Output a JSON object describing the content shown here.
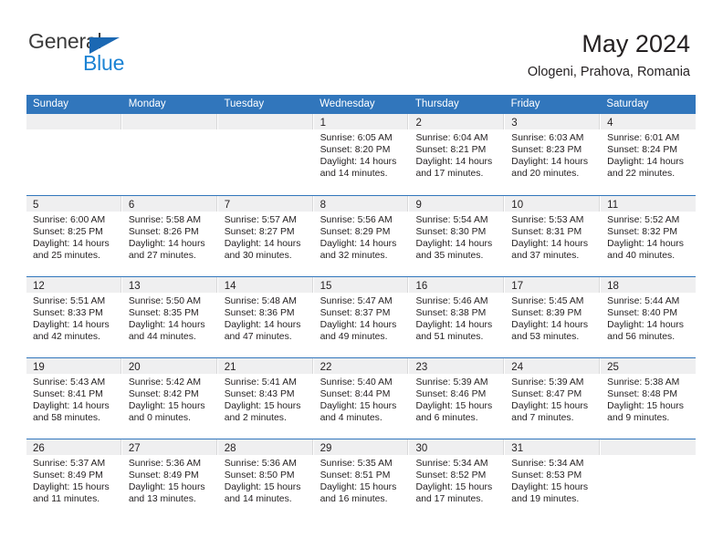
{
  "brand": {
    "name_part1": "General",
    "name_part2": "Blue",
    "flag_icon": "triangle-flag-icon",
    "color_dark": "#3b3b3b",
    "color_blue": "#1b83d4"
  },
  "header": {
    "title": "May 2024",
    "subtitle": "Ologeni, Prahova, Romania"
  },
  "theme": {
    "header_blue": "#3176bc",
    "day_head_gray": "#efeff0",
    "text": "#231f20"
  },
  "calendar": {
    "weekdays": [
      "Sunday",
      "Monday",
      "Tuesday",
      "Wednesday",
      "Thursday",
      "Friday",
      "Saturday"
    ],
    "weeks": [
      [
        {
          "day": "",
          "lines": []
        },
        {
          "day": "",
          "lines": []
        },
        {
          "day": "",
          "lines": []
        },
        {
          "day": "1",
          "lines": [
            "Sunrise: 6:05 AM",
            "Sunset: 8:20 PM",
            "Daylight: 14 hours",
            "and 14 minutes."
          ]
        },
        {
          "day": "2",
          "lines": [
            "Sunrise: 6:04 AM",
            "Sunset: 8:21 PM",
            "Daylight: 14 hours",
            "and 17 minutes."
          ]
        },
        {
          "day": "3",
          "lines": [
            "Sunrise: 6:03 AM",
            "Sunset: 8:23 PM",
            "Daylight: 14 hours",
            "and 20 minutes."
          ]
        },
        {
          "day": "4",
          "lines": [
            "Sunrise: 6:01 AM",
            "Sunset: 8:24 PM",
            "Daylight: 14 hours",
            "and 22 minutes."
          ]
        }
      ],
      [
        {
          "day": "5",
          "lines": [
            "Sunrise: 6:00 AM",
            "Sunset: 8:25 PM",
            "Daylight: 14 hours",
            "and 25 minutes."
          ]
        },
        {
          "day": "6",
          "lines": [
            "Sunrise: 5:58 AM",
            "Sunset: 8:26 PM",
            "Daylight: 14 hours",
            "and 27 minutes."
          ]
        },
        {
          "day": "7",
          "lines": [
            "Sunrise: 5:57 AM",
            "Sunset: 8:27 PM",
            "Daylight: 14 hours",
            "and 30 minutes."
          ]
        },
        {
          "day": "8",
          "lines": [
            "Sunrise: 5:56 AM",
            "Sunset: 8:29 PM",
            "Daylight: 14 hours",
            "and 32 minutes."
          ]
        },
        {
          "day": "9",
          "lines": [
            "Sunrise: 5:54 AM",
            "Sunset: 8:30 PM",
            "Daylight: 14 hours",
            "and 35 minutes."
          ]
        },
        {
          "day": "10",
          "lines": [
            "Sunrise: 5:53 AM",
            "Sunset: 8:31 PM",
            "Daylight: 14 hours",
            "and 37 minutes."
          ]
        },
        {
          "day": "11",
          "lines": [
            "Sunrise: 5:52 AM",
            "Sunset: 8:32 PM",
            "Daylight: 14 hours",
            "and 40 minutes."
          ]
        }
      ],
      [
        {
          "day": "12",
          "lines": [
            "Sunrise: 5:51 AM",
            "Sunset: 8:33 PM",
            "Daylight: 14 hours",
            "and 42 minutes."
          ]
        },
        {
          "day": "13",
          "lines": [
            "Sunrise: 5:50 AM",
            "Sunset: 8:35 PM",
            "Daylight: 14 hours",
            "and 44 minutes."
          ]
        },
        {
          "day": "14",
          "lines": [
            "Sunrise: 5:48 AM",
            "Sunset: 8:36 PM",
            "Daylight: 14 hours",
            "and 47 minutes."
          ]
        },
        {
          "day": "15",
          "lines": [
            "Sunrise: 5:47 AM",
            "Sunset: 8:37 PM",
            "Daylight: 14 hours",
            "and 49 minutes."
          ]
        },
        {
          "day": "16",
          "lines": [
            "Sunrise: 5:46 AM",
            "Sunset: 8:38 PM",
            "Daylight: 14 hours",
            "and 51 minutes."
          ]
        },
        {
          "day": "17",
          "lines": [
            "Sunrise: 5:45 AM",
            "Sunset: 8:39 PM",
            "Daylight: 14 hours",
            "and 53 minutes."
          ]
        },
        {
          "day": "18",
          "lines": [
            "Sunrise: 5:44 AM",
            "Sunset: 8:40 PM",
            "Daylight: 14 hours",
            "and 56 minutes."
          ]
        }
      ],
      [
        {
          "day": "19",
          "lines": [
            "Sunrise: 5:43 AM",
            "Sunset: 8:41 PM",
            "Daylight: 14 hours",
            "and 58 minutes."
          ]
        },
        {
          "day": "20",
          "lines": [
            "Sunrise: 5:42 AM",
            "Sunset: 8:42 PM",
            "Daylight: 15 hours",
            "and 0 minutes."
          ]
        },
        {
          "day": "21",
          "lines": [
            "Sunrise: 5:41 AM",
            "Sunset: 8:43 PM",
            "Daylight: 15 hours",
            "and 2 minutes."
          ]
        },
        {
          "day": "22",
          "lines": [
            "Sunrise: 5:40 AM",
            "Sunset: 8:44 PM",
            "Daylight: 15 hours",
            "and 4 minutes."
          ]
        },
        {
          "day": "23",
          "lines": [
            "Sunrise: 5:39 AM",
            "Sunset: 8:46 PM",
            "Daylight: 15 hours",
            "and 6 minutes."
          ]
        },
        {
          "day": "24",
          "lines": [
            "Sunrise: 5:39 AM",
            "Sunset: 8:47 PM",
            "Daylight: 15 hours",
            "and 7 minutes."
          ]
        },
        {
          "day": "25",
          "lines": [
            "Sunrise: 5:38 AM",
            "Sunset: 8:48 PM",
            "Daylight: 15 hours",
            "and 9 minutes."
          ]
        }
      ],
      [
        {
          "day": "26",
          "lines": [
            "Sunrise: 5:37 AM",
            "Sunset: 8:49 PM",
            "Daylight: 15 hours",
            "and 11 minutes."
          ]
        },
        {
          "day": "27",
          "lines": [
            "Sunrise: 5:36 AM",
            "Sunset: 8:49 PM",
            "Daylight: 15 hours",
            "and 13 minutes."
          ]
        },
        {
          "day": "28",
          "lines": [
            "Sunrise: 5:36 AM",
            "Sunset: 8:50 PM",
            "Daylight: 15 hours",
            "and 14 minutes."
          ]
        },
        {
          "day": "29",
          "lines": [
            "Sunrise: 5:35 AM",
            "Sunset: 8:51 PM",
            "Daylight: 15 hours",
            "and 16 minutes."
          ]
        },
        {
          "day": "30",
          "lines": [
            "Sunrise: 5:34 AM",
            "Sunset: 8:52 PM",
            "Daylight: 15 hours",
            "and 17 minutes."
          ]
        },
        {
          "day": "31",
          "lines": [
            "Sunrise: 5:34 AM",
            "Sunset: 8:53 PM",
            "Daylight: 15 hours",
            "and 19 minutes."
          ]
        },
        {
          "day": "",
          "lines": []
        }
      ]
    ]
  }
}
